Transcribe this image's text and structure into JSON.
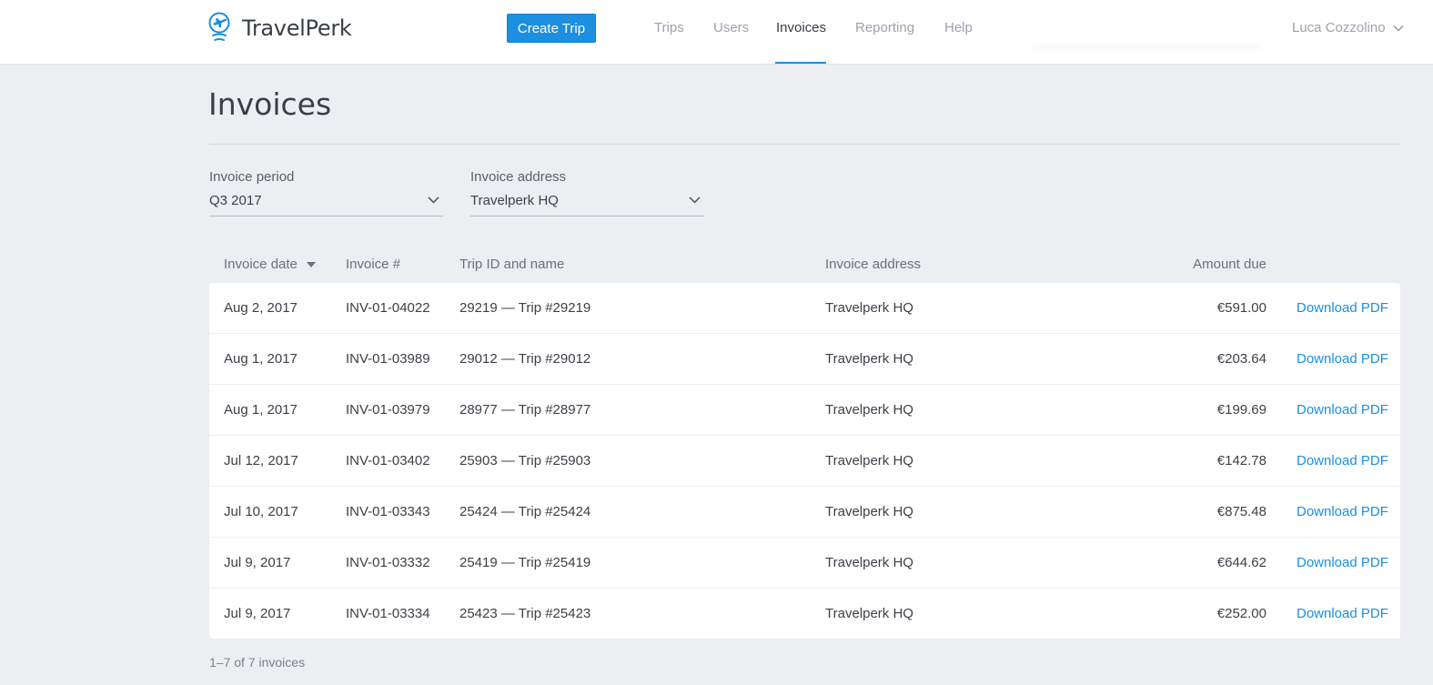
{
  "header": {
    "brand": "TravelPerk",
    "create_trip_label": "Create Trip",
    "nav": [
      {
        "label": "Trips",
        "active": false
      },
      {
        "label": "Users",
        "active": false
      },
      {
        "label": "Invoices",
        "active": true
      },
      {
        "label": "Reporting",
        "active": false
      },
      {
        "label": "Help",
        "active": false
      }
    ],
    "user_name": "Luca Cozzolino"
  },
  "page": {
    "title": "Invoices"
  },
  "filters": {
    "period": {
      "label": "Invoice period",
      "value": "Q3 2017"
    },
    "address": {
      "label": "Invoice address",
      "value": "Travelperk HQ"
    }
  },
  "table": {
    "columns": {
      "date": "Invoice date",
      "number": "Invoice #",
      "trip": "Trip ID and name",
      "address": "Invoice address",
      "amount": "Amount due"
    },
    "sort_column": "Invoice date",
    "rows": [
      {
        "date": "Aug 2, 2017",
        "number": "INV-01-04022",
        "trip": "29219 — Trip #29219",
        "address": "Travelperk HQ",
        "amount": "€591.00",
        "action": "Download PDF"
      },
      {
        "date": "Aug 1, 2017",
        "number": "INV-01-03989",
        "trip": "29012 — Trip #29012",
        "address": "Travelperk HQ",
        "amount": "€203.64",
        "action": "Download PDF"
      },
      {
        "date": "Aug 1, 2017",
        "number": "INV-01-03979",
        "trip": "28977 — Trip #28977",
        "address": "Travelperk HQ",
        "amount": "€199.69",
        "action": "Download PDF"
      },
      {
        "date": "Jul 12, 2017",
        "number": "INV-01-03402",
        "trip": "25903 — Trip #25903",
        "address": "Travelperk HQ",
        "amount": "€142.78",
        "action": "Download PDF"
      },
      {
        "date": "Jul 10, 2017",
        "number": "INV-01-03343",
        "trip": "25424 — Trip #25424",
        "address": "Travelperk HQ",
        "amount": "€875.48",
        "action": "Download PDF"
      },
      {
        "date": "Jul 9, 2017",
        "number": "INV-01-03332",
        "trip": "25419 — Trip #25419",
        "address": "Travelperk HQ",
        "amount": "€644.62",
        "action": "Download PDF"
      },
      {
        "date": "Jul 9, 2017",
        "number": "INV-01-03334",
        "trip": "25423 — Trip #25423",
        "address": "Travelperk HQ",
        "amount": "€252.00",
        "action": "Download PDF"
      }
    ]
  },
  "pagination": {
    "summary": "1–7 of 7 invoices"
  },
  "colors": {
    "accent": "#1b8fe0",
    "background": "#eceef1"
  },
  "icons": {
    "logo": "airplane-globe-icon",
    "user_menu": "chevron-down-icon",
    "select": "chevron-down-icon",
    "sort": "sort-desc-icon"
  }
}
